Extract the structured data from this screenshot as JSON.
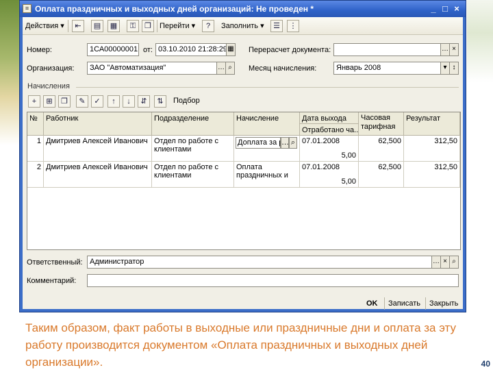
{
  "window": {
    "title": "Оплата праздничных и выходных дней организаций: Не проведен *",
    "minimize_glyph": "_",
    "maximize_glyph": "□",
    "close_glyph": "×"
  },
  "toolbar": {
    "actions_label": "Действия",
    "goto_label": "Перейти",
    "fill_label": "Заполнить",
    "help_glyph": "?",
    "dropdown_glyph": "▾",
    "icons": [
      "arrow-left-icon",
      "document-icon",
      "post-icon",
      "lock-icon",
      "copy-icon",
      "structure-icon",
      "options-icon"
    ]
  },
  "form": {
    "number_label": "Номер:",
    "number_value": "1СА00000001",
    "from_label": "от:",
    "date_value": "03.10.2010 21:28:29",
    "organization_label": "Организация:",
    "organization_value": "ЗАО \"Автоматизация\"",
    "recalc_label": "Перерасчет документа:",
    "recalc_value": "",
    "month_label": "Месяц начисления:",
    "month_value": "Январь 2008",
    "section_label": "Начисления",
    "pick_label": "Подбор",
    "responsible_label": "Ответственный:",
    "responsible_value": "Администратор",
    "comment_label": "Комментарий:",
    "comment_value": ""
  },
  "grid": {
    "headers": {
      "num": "№",
      "employee": "Работник",
      "department": "Подразделение",
      "accrual": "Начисление",
      "date": "Дата выхода",
      "worked": "Отработано ча...",
      "rate": "Часовая",
      "rate2": "тарифная",
      "result": "Результат"
    },
    "rows": [
      {
        "num": "1",
        "employee": "Дмитриев Алексей Иванович",
        "department": "Отдел по работе с клиентами",
        "accrual": "Доплата за р",
        "date": "07.01.2008",
        "worked": "5,00",
        "rate": "62,500",
        "result": "312,50"
      },
      {
        "num": "2",
        "employee": "Дмитриев Алексей Иванович",
        "department": "Отдел по работе с клиентами",
        "accrual": "Оплата праздничных и",
        "date": "07.01.2008",
        "worked": "5,00",
        "rate": "62,500",
        "result": "312,50"
      }
    ]
  },
  "footer": {
    "ok_label": "OK",
    "save_label": "Записать",
    "close_label": "Закрыть"
  },
  "caption": "Таким образом, факт работы в выходные или праздничные дни и оплата за эту работу производится документом «Оплата праздничных и выходных дней организации».",
  "page_number": "40",
  "colors": {
    "titlebar": "#2f62c8",
    "client": "#f1efe6",
    "caption": "#d9792b"
  }
}
